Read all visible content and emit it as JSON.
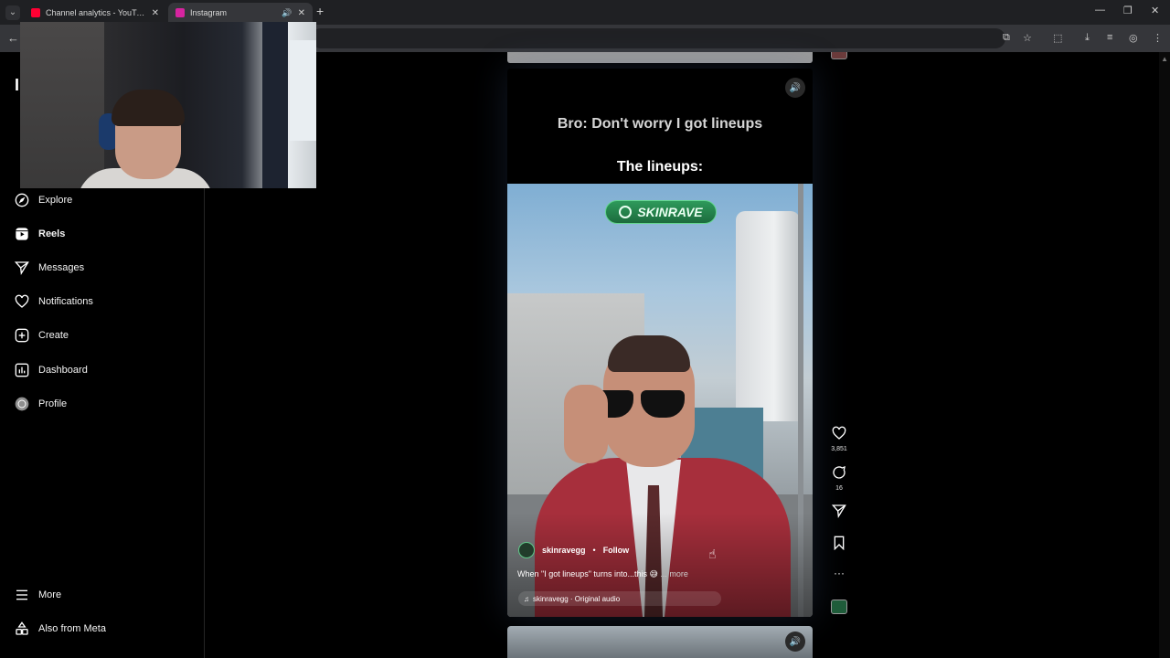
{
  "browser": {
    "tabs": [
      {
        "title": "Channel analytics - YouTube St",
        "favicon_color": "#ff0033"
      },
      {
        "title": "Instagram",
        "favicon_color": "#d6249f"
      }
    ]
  },
  "sidebar": {
    "items": [
      {
        "label": "Explore",
        "icon": "compass-icon"
      },
      {
        "label": "Reels",
        "icon": "reels-icon",
        "active": true
      },
      {
        "label": "Messages",
        "icon": "send-icon"
      },
      {
        "label": "Notifications",
        "icon": "heart-icon"
      },
      {
        "label": "Create",
        "icon": "plus-square-icon"
      },
      {
        "label": "Dashboard",
        "icon": "chart-icon"
      },
      {
        "label": "Profile",
        "icon": "avatar-icon"
      }
    ],
    "bottom": [
      {
        "label": "More",
        "icon": "menu-icon"
      },
      {
        "label": "Also from Meta",
        "icon": "meta-icon"
      }
    ]
  },
  "reel": {
    "caption_line_1": "Bro: Don't worry I got lineups",
    "caption_line_2": "The lineups:",
    "brand": "SKINRAVE",
    "author": "skinravegg",
    "separator": "•",
    "follow": "Follow",
    "description": "When \"I got lineups\" turns into...this 😅",
    "more": "... more",
    "audio": "skinravegg · Original audio"
  },
  "actions": {
    "likes": "3,851",
    "comments": "16"
  }
}
